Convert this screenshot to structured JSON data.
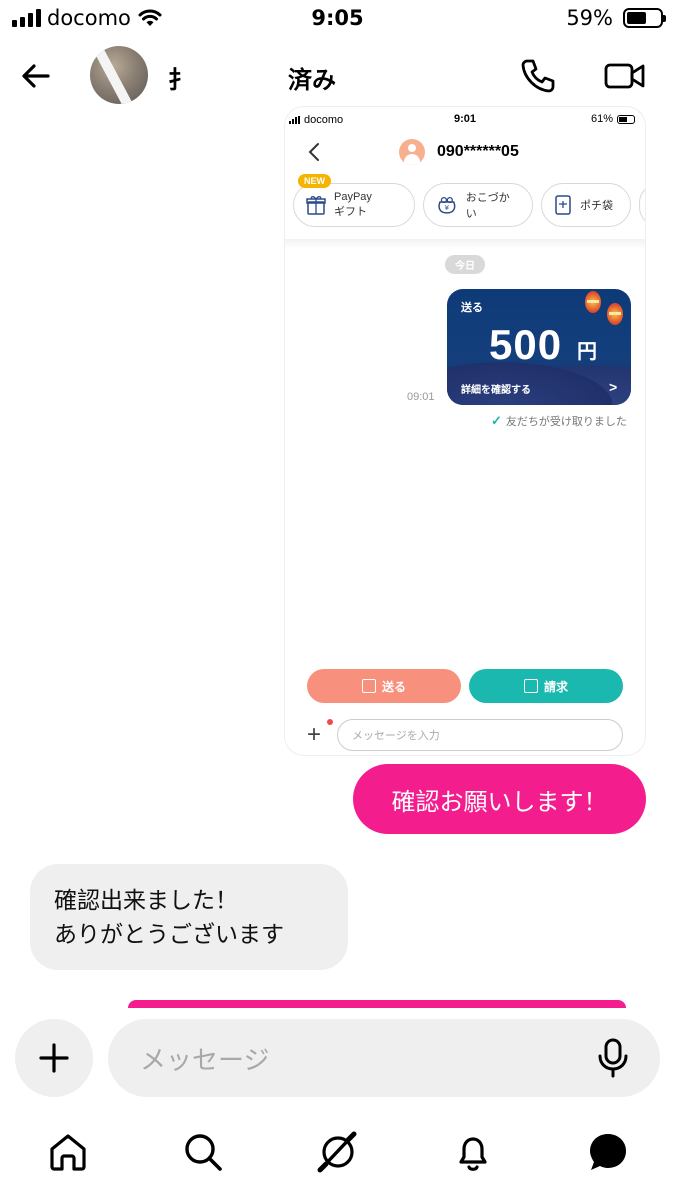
{
  "status_bar": {
    "carrier": "docomo",
    "time": "9:05",
    "battery": "59%",
    "battery_level": 0.59
  },
  "header": {
    "title_visible": "済み"
  },
  "embedded_screenshot": {
    "status": {
      "carrier": "docomo",
      "time": "9:01",
      "battery": "61%"
    },
    "contact_number": "090******05",
    "chips": [
      {
        "badge": "NEW",
        "label_line1": "PayPay",
        "label_line2": "ギフト",
        "icon": "gift-icon"
      },
      {
        "label": "おこづかい",
        "icon": "coin-purse-icon"
      },
      {
        "label": "ポチ袋",
        "icon": "envelope-icon"
      }
    ],
    "date_label": "今日",
    "payment_card": {
      "label": "送る",
      "amount": "500",
      "unit": "円",
      "detail": "詳細を確認する"
    },
    "card_time": "09:01",
    "received_status": "友だちが受け取りました",
    "send_button": "送る",
    "request_button": "請求",
    "input_placeholder": "メッセージを入力"
  },
  "messages": {
    "outgoing": "確認お願いします！",
    "incoming_line1": "確認出来ました！",
    "incoming_line2": "ありがとうございます"
  },
  "composer": {
    "placeholder": "メッセージ"
  },
  "colors": {
    "accent_pink": "#f41d8d",
    "bubble_gray": "#efefef",
    "send_coral": "#f7917e",
    "request_teal": "#1bb8b0",
    "card_navy": "#0e3a78"
  },
  "tabbar": {
    "icons": [
      "home-icon",
      "search-icon",
      "explore-icon",
      "notifications-bell-icon",
      "messages-icon"
    ]
  }
}
